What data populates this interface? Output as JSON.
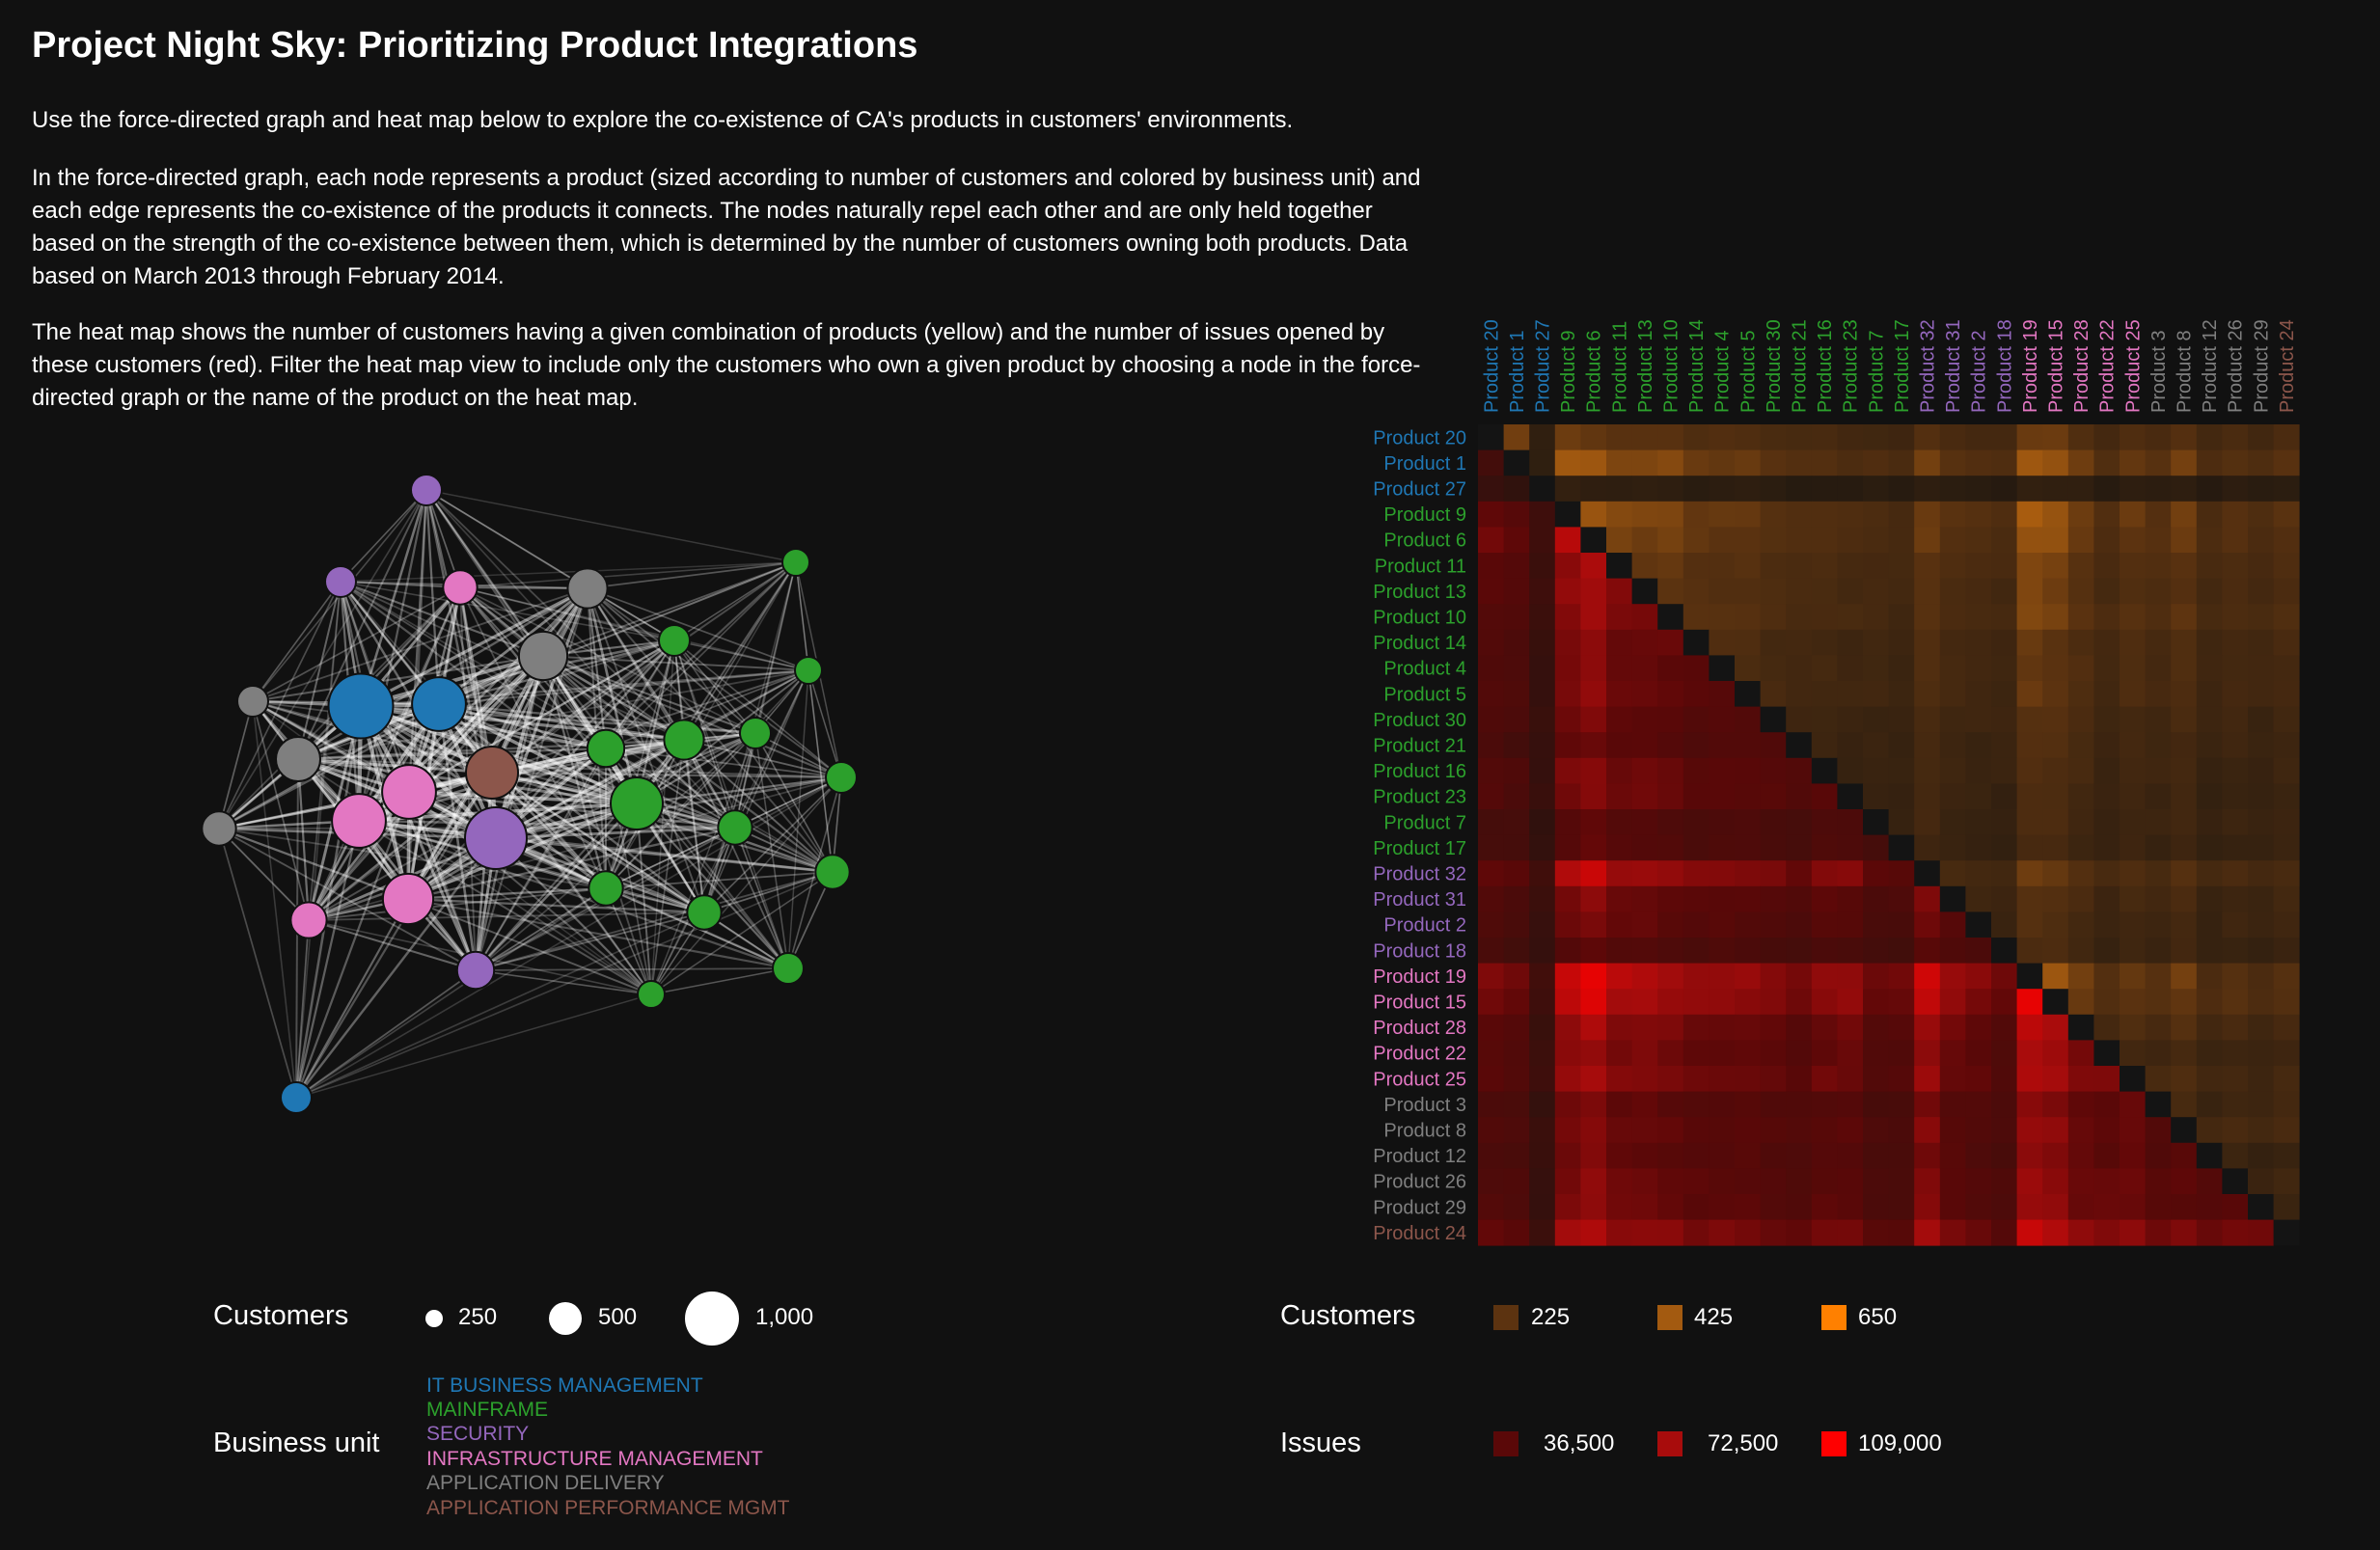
{
  "page": {
    "title": "Project Night Sky: Prioritizing Product Integrations",
    "intro": [
      "Use the force-directed graph and heat map below to explore the co-existence of CA's products in customers' environments.",
      "In the force-directed graph, each node represents a product (sized according to number of customers and colored by business unit) and each edge represents the co-existence of the products it connects. The nodes naturally repel each other and are only held together based on the strength of the co-existence between them, which is determined by the number of customers owning both products. Data based on March 2013 through February 2014.",
      "The heat map shows the number of customers having a given combination of products (yellow) and the number of issues opened by these customers (red). Filter the heat map view to include only the customers who own a given product by choosing a node in the force-directed graph or the name of the product on the heat map."
    ]
  },
  "colors": {
    "background": "#111111",
    "IT BUSINESS MANAGEMENT": "#1f77b4",
    "MAINFRAME": "#2ca02c",
    "SECURITY": "#9467bd",
    "INFRASTRUCTURE MANAGEMENT": "#e377c2",
    "APPLICATION DELIVERY": "#7f7f7f",
    "APPLICATION PERFORMANCE MGMT": "#8c564b",
    "customers_scale": [
      "#5c3310",
      "#a35a10",
      "#ff8000"
    ],
    "issues_scale": [
      "#5a0808",
      "#a80c0c",
      "#ff0000"
    ]
  },
  "legends": {
    "size": {
      "title": "Customers",
      "items": [
        {
          "value": 250,
          "label": "250"
        },
        {
          "value": 500,
          "label": "500"
        },
        {
          "value": 1000,
          "label": "1,000"
        }
      ]
    },
    "business_unit": {
      "title": "Business unit",
      "items": [
        "IT BUSINESS MANAGEMENT",
        "MAINFRAME",
        "SECURITY",
        "INFRASTRUCTURE MANAGEMENT",
        "APPLICATION DELIVERY",
        "APPLICATION PERFORMANCE MGMT"
      ]
    },
    "heat_customers": {
      "title": "Customers",
      "items": [
        {
          "value": 225,
          "label": "225"
        },
        {
          "value": 425,
          "label": "425"
        },
        {
          "value": 650,
          "label": "650"
        }
      ]
    },
    "heat_issues": {
      "title": "Issues",
      "items": [
        {
          "value": 36500,
          "label": "36,500"
        },
        {
          "value": 72500,
          "label": "72,500"
        },
        {
          "value": 109000,
          "label": "109,000"
        }
      ]
    }
  },
  "chart_data": [
    {
      "type": "network",
      "nodes": [
        {
          "bu": "SECURITY",
          "customers": 150
        },
        {
          "bu": "SECURITY",
          "customers": 150
        },
        {
          "bu": "INFRASTRUCTURE MANAGEMENT",
          "customers": 200
        },
        {
          "bu": "APPLICATION DELIVERY",
          "customers": 300
        },
        {
          "bu": "MAINFRAME",
          "customers": 100
        },
        {
          "bu": "APPLICATION DELIVERY",
          "customers": 500
        },
        {
          "bu": "MAINFRAME",
          "customers": 150
        },
        {
          "bu": "MAINFRAME",
          "customers": 100
        },
        {
          "bu": "APPLICATION DELIVERY",
          "customers": 150
        },
        {
          "bu": "IT BUSINESS MANAGEMENT",
          "customers": 1000
        },
        {
          "bu": "IT BUSINESS MANAGEMENT",
          "customers": 650
        },
        {
          "bu": "MAINFRAME",
          "customers": 250
        },
        {
          "bu": "MAINFRAME",
          "customers": 300
        },
        {
          "bu": "MAINFRAME",
          "customers": 150
        },
        {
          "bu": "APPLICATION DELIVERY",
          "customers": 400
        },
        {
          "bu": "APPLICATION PERFORMANCE MGMT",
          "customers": 600
        },
        {
          "bu": "INFRASTRUCTURE MANAGEMENT",
          "customers": 650
        },
        {
          "bu": "MAINFRAME",
          "customers": 600
        },
        {
          "bu": "MAINFRAME",
          "customers": 200
        },
        {
          "bu": "MAINFRAME",
          "customers": 200
        },
        {
          "bu": "INFRASTRUCTURE MANAGEMENT",
          "customers": 650
        },
        {
          "bu": "APPLICATION DELIVERY",
          "customers": 200
        },
        {
          "bu": "SECURITY",
          "customers": 900
        },
        {
          "bu": "MAINFRAME",
          "customers": 150
        },
        {
          "bu": "MAINFRAME",
          "customers": 200
        },
        {
          "bu": "INFRASTRUCTURE MANAGEMENT",
          "customers": 550
        },
        {
          "bu": "INFRASTRUCTURE MANAGEMENT",
          "customers": 230
        },
        {
          "bu": "MAINFRAME",
          "customers": 200
        },
        {
          "bu": "SECURITY",
          "customers": 250
        },
        {
          "bu": "MAINFRAME",
          "customers": 150
        },
        {
          "bu": "MAINFRAME",
          "customers": 100
        },
        {
          "bu": "IT BUSINESS MANAGEMENT",
          "customers": 150
        }
      ]
    },
    {
      "type": "heatmap",
      "products": [
        {
          "name": "Product 20",
          "bu": "IT BUSINESS MANAGEMENT"
        },
        {
          "name": "Product 1",
          "bu": "IT BUSINESS MANAGEMENT"
        },
        {
          "name": "Product 27",
          "bu": "IT BUSINESS MANAGEMENT"
        },
        {
          "name": "Product 9",
          "bu": "MAINFRAME"
        },
        {
          "name": "Product 6",
          "bu": "MAINFRAME"
        },
        {
          "name": "Product 11",
          "bu": "MAINFRAME"
        },
        {
          "name": "Product 13",
          "bu": "MAINFRAME"
        },
        {
          "name": "Product 10",
          "bu": "MAINFRAME"
        },
        {
          "name": "Product 14",
          "bu": "MAINFRAME"
        },
        {
          "name": "Product 4",
          "bu": "MAINFRAME"
        },
        {
          "name": "Product 5",
          "bu": "MAINFRAME"
        },
        {
          "name": "Product 30",
          "bu": "MAINFRAME"
        },
        {
          "name": "Product 21",
          "bu": "MAINFRAME"
        },
        {
          "name": "Product 16",
          "bu": "MAINFRAME"
        },
        {
          "name": "Product 23",
          "bu": "MAINFRAME"
        },
        {
          "name": "Product 7",
          "bu": "MAINFRAME"
        },
        {
          "name": "Product 17",
          "bu": "MAINFRAME"
        },
        {
          "name": "Product 32",
          "bu": "SECURITY"
        },
        {
          "name": "Product 31",
          "bu": "SECURITY"
        },
        {
          "name": "Product 2",
          "bu": "SECURITY"
        },
        {
          "name": "Product 18",
          "bu": "SECURITY"
        },
        {
          "name": "Product 19",
          "bu": "INFRASTRUCTURE MANAGEMENT"
        },
        {
          "name": "Product 15",
          "bu": "INFRASTRUCTURE MANAGEMENT"
        },
        {
          "name": "Product 28",
          "bu": "INFRASTRUCTURE MANAGEMENT"
        },
        {
          "name": "Product 22",
          "bu": "INFRASTRUCTURE MANAGEMENT"
        },
        {
          "name": "Product 25",
          "bu": "INFRASTRUCTURE MANAGEMENT"
        },
        {
          "name": "Product 3",
          "bu": "APPLICATION DELIVERY"
        },
        {
          "name": "Product 8",
          "bu": "APPLICATION DELIVERY"
        },
        {
          "name": "Product 12",
          "bu": "APPLICATION DELIVERY"
        },
        {
          "name": "Product 26",
          "bu": "APPLICATION DELIVERY"
        },
        {
          "name": "Product 29",
          "bu": "APPLICATION DELIVERY"
        },
        {
          "name": "Product 24",
          "bu": "APPLICATION PERFORMANCE MGMT"
        }
      ],
      "upper_triangle": "customers",
      "lower_triangle": "issues",
      "customers_range": [
        0,
        650
      ],
      "issues_range": [
        0,
        109000
      ],
      "customer_factor": [
        0.75,
        1.0,
        0.2,
        1.0,
        0.95,
        0.85,
        0.8,
        0.85,
        0.7,
        0.7,
        0.7,
        0.6,
        0.55,
        0.55,
        0.5,
        0.5,
        0.45,
        0.75,
        0.6,
        0.55,
        0.5,
        1.0,
        0.95,
        0.75,
        0.55,
        0.7,
        0.6,
        0.75,
        0.5,
        0.6,
        0.5,
        0.6
      ],
      "issue_factor": [
        0.6,
        0.55,
        0.3,
        0.85,
        0.95,
        0.8,
        0.8,
        0.75,
        0.7,
        0.7,
        0.7,
        0.65,
        0.6,
        0.7,
        0.7,
        0.55,
        0.55,
        0.9,
        0.7,
        0.65,
        0.55,
        1.0,
        0.95,
        0.8,
        0.75,
        0.8,
        0.65,
        0.7,
        0.65,
        0.7,
        0.7,
        0.85
      ]
    }
  ]
}
